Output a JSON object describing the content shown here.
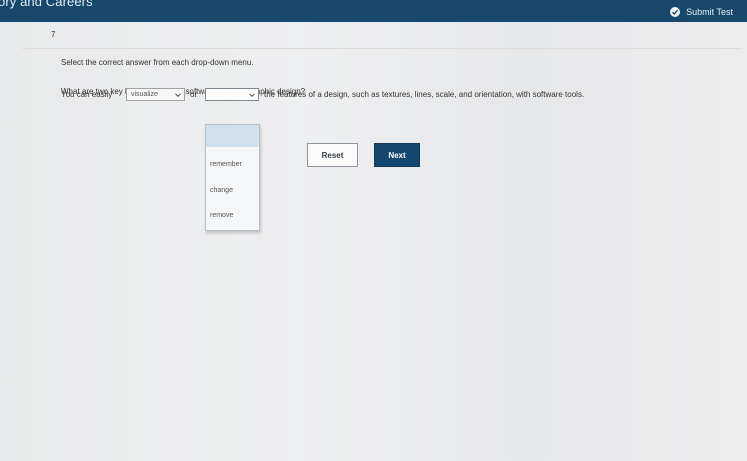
{
  "header": {
    "title": "ory and Careers",
    "submit_label": "Submit Test"
  },
  "question": {
    "number": "7",
    "instruction": "Select the correct answer from each drop-down menu.",
    "prompt": "What are two key benefits of using software tools for graphic design?",
    "sentence_start": "You can easily",
    "connector": "or",
    "sentence_end": "the features of a design, such as textures, lines, scale, and orientation, with software tools.",
    "dropdown1": {
      "selected": "visualize"
    },
    "dropdown2": {
      "selected": "",
      "options": [
        "remember",
        "change",
        "remove"
      ]
    }
  },
  "buttons": {
    "reset_label": "Reset",
    "next_label": "Next"
  },
  "colors": {
    "header_bg": "#17476b",
    "next_bg": "#13476d",
    "menu_highlight": "#cfe0ee"
  }
}
